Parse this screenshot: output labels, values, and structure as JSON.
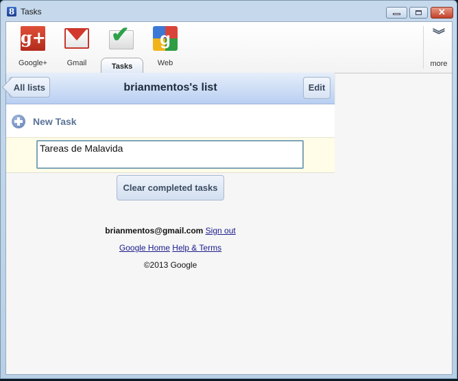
{
  "window": {
    "title": "Tasks",
    "app_icon": "google-g-icon",
    "controls": {
      "minimize": "minimize-icon",
      "maximize": "maximize-icon",
      "close": "close-icon"
    },
    "close_glyph": "✕"
  },
  "toolbar": {
    "items": [
      {
        "label": "Google+",
        "icon": "google-plus-icon",
        "glyph": "g+"
      },
      {
        "label": "Gmail",
        "icon": "gmail-icon"
      },
      {
        "label": "Tasks",
        "icon": "tasks-checkmark-icon",
        "glyph": "✔",
        "active": true
      },
      {
        "label": "Web",
        "icon": "google-web-icon",
        "glyph": "g"
      }
    ],
    "more": {
      "label": "more",
      "icon": "double-chevron-down-icon",
      "glyph": "︾"
    }
  },
  "list": {
    "back_label": "All lists",
    "title": "brianmentos's list",
    "edit_label": "Edit",
    "new_task_label": "New Task",
    "task_value": "Tareas de Malavida",
    "clear_label": "Clear completed tasks"
  },
  "footer": {
    "email": "brianmentos@gmail.com",
    "sign_out": "Sign out",
    "google_home": "Google Home",
    "help_terms": "Help & Terms",
    "copyright": "©2013 Google"
  },
  "colors": {
    "accent_blue": "#b9cff2",
    "task_row_bg": "#fffde8",
    "link": "#1a1a8c"
  }
}
